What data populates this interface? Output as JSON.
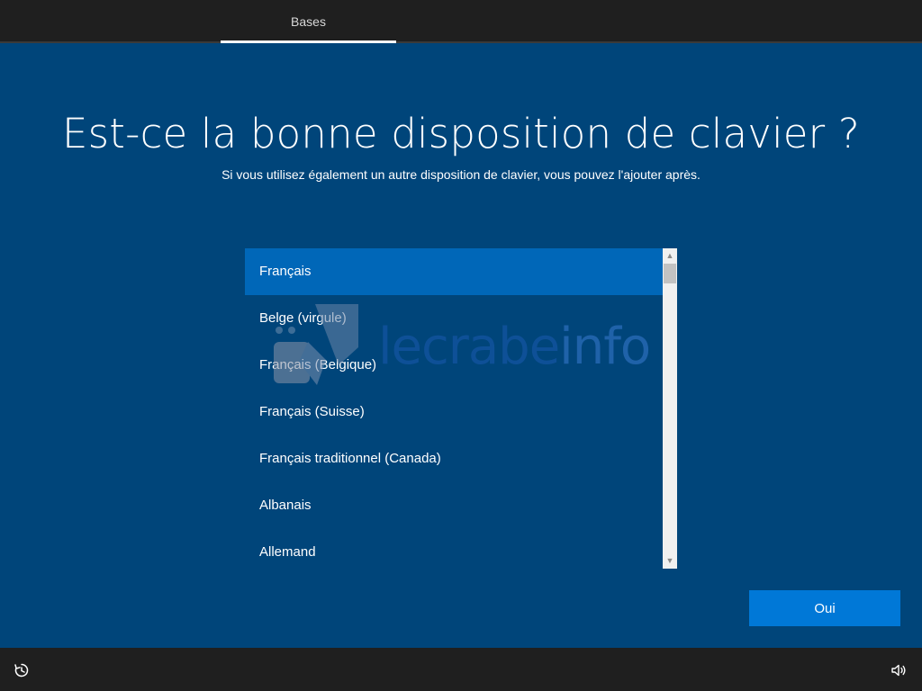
{
  "header": {
    "tab_label": "Bases"
  },
  "main": {
    "title": "Est-ce la bonne disposition de clavier ?",
    "subtitle": "Si vous utilisez également un autre disposition de clavier, vous pouvez l'ajouter après.",
    "layouts": [
      "Français",
      "Belge (virgule)",
      "Français (Belgique)",
      "Français (Suisse)",
      "Français traditionnel (Canada)",
      "Albanais",
      "Allemand"
    ],
    "selected_index": 0,
    "confirm_label": "Oui"
  },
  "watermark": {
    "part1": "lecrabe",
    "part2": "info"
  },
  "footer": {
    "left_icon": "accessibility-icon",
    "right_icon": "volume-icon"
  },
  "colors": {
    "background": "#00457a",
    "bar": "#1f1f1f",
    "selection": "#0067b8",
    "button": "#0078d7"
  }
}
